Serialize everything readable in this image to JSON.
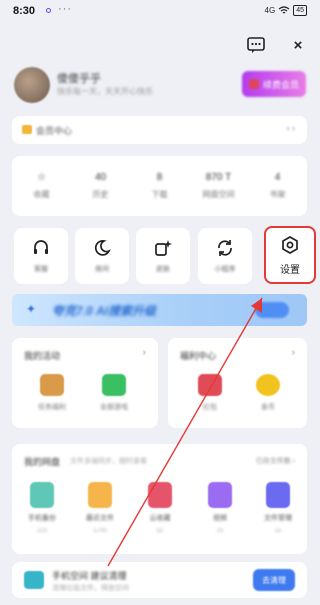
{
  "status_bar": {
    "time": "8:30",
    "more": "···",
    "network": "4G",
    "battery": "45"
  },
  "top_actions": {
    "message_icon": "message-dots-icon",
    "close_label": "×"
  },
  "profile": {
    "name": "傻傻乎乎",
    "subtitle": "快乐每一天，天天开心快乐",
    "vip_button": "续费会员"
  },
  "vip_card": {
    "label": "会员中心",
    "more": "› ›"
  },
  "stats": [
    {
      "value": "☆",
      "label": "收藏"
    },
    {
      "value": "40",
      "label": "历史"
    },
    {
      "value": "8",
      "label": "下载"
    },
    {
      "value": "870 T",
      "label": "网盘空间"
    },
    {
      "value": "4",
      "label": "书架"
    }
  ],
  "tools": [
    {
      "label": "客服",
      "icon": "headset-icon"
    },
    {
      "label": "夜间",
      "icon": "moon-icon"
    },
    {
      "label": "皮肤",
      "icon": "sparkle-icon"
    },
    {
      "label": "小程序",
      "icon": "refresh-icon"
    },
    {
      "label": "设置",
      "icon": "hexagon-gear-icon"
    }
  ],
  "banner": {
    "text": "夸克7.0 AI搜索升级",
    "spark": "✦"
  },
  "left_card": {
    "title": "我的活动",
    "arrow": "›",
    "items": [
      {
        "label": "任务福利",
        "color": "#d99a4a"
      },
      {
        "label": "全部游戏",
        "color": "#3bbf63"
      }
    ]
  },
  "right_card": {
    "title": "福利中心",
    "arrow": "›",
    "items": [
      {
        "label": "红包",
        "color": "#e04b55"
      },
      {
        "label": "金币",
        "color": "#f2c21e"
      }
    ]
  },
  "files_card": {
    "title": "我的网盘",
    "subtitle": "文件多端同步，随时查看",
    "right": "已存文件数 ›",
    "items": [
      {
        "label": "手机备份",
        "count": "223",
        "color": "#5ec7b6"
      },
      {
        "label": "最近文件",
        "count": "1700",
        "color": "#f5b54a"
      },
      {
        "label": "云收藏",
        "count": "52",
        "color": "#e5546a"
      },
      {
        "label": "视频",
        "count": "25",
        "color": "#9a6cf1"
      },
      {
        "label": "文件管理",
        "count": "15",
        "color": "#6a6bf0"
      }
    ]
  },
  "cleanup": {
    "title": "手机空间 建议清理",
    "subtitle": "清理垃圾文件，释放空间",
    "button": "去清理"
  },
  "annotation_color": "#e53935"
}
